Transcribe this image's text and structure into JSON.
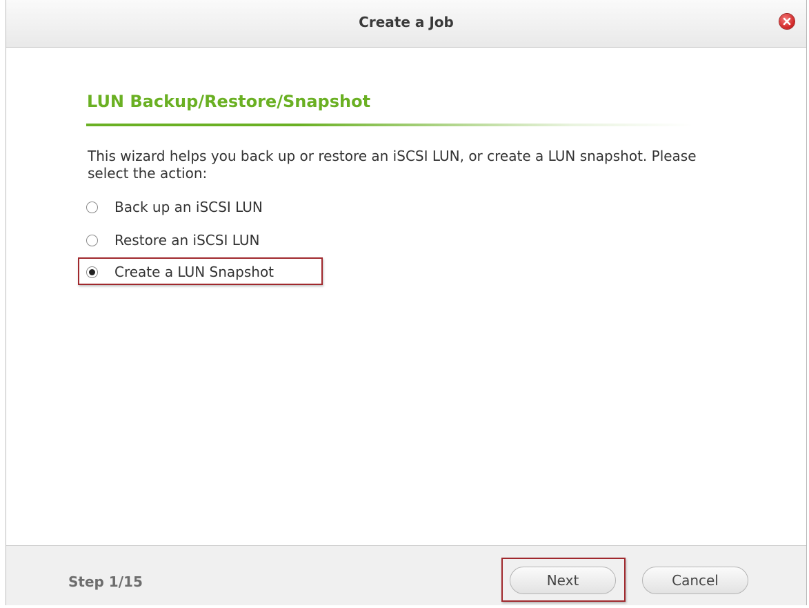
{
  "dialog": {
    "title": "Create a Job",
    "close_icon": "close-icon"
  },
  "content": {
    "heading": "LUN Backup/Restore/Snapshot",
    "description": "This wizard helps you back up or restore an iSCSI LUN, or create a LUN snapshot. Please select the action:",
    "options": [
      {
        "label": "Back up an iSCSI LUN",
        "selected": false
      },
      {
        "label": "Restore an iSCSI LUN",
        "selected": false
      },
      {
        "label": "Create a LUN Snapshot",
        "selected": true
      }
    ]
  },
  "footer": {
    "step": "Step 1/15",
    "next_label": "Next",
    "cancel_label": "Cancel"
  },
  "colors": {
    "accent": "#6ab023",
    "highlight": "#a0282d",
    "close": "#cf2424"
  }
}
